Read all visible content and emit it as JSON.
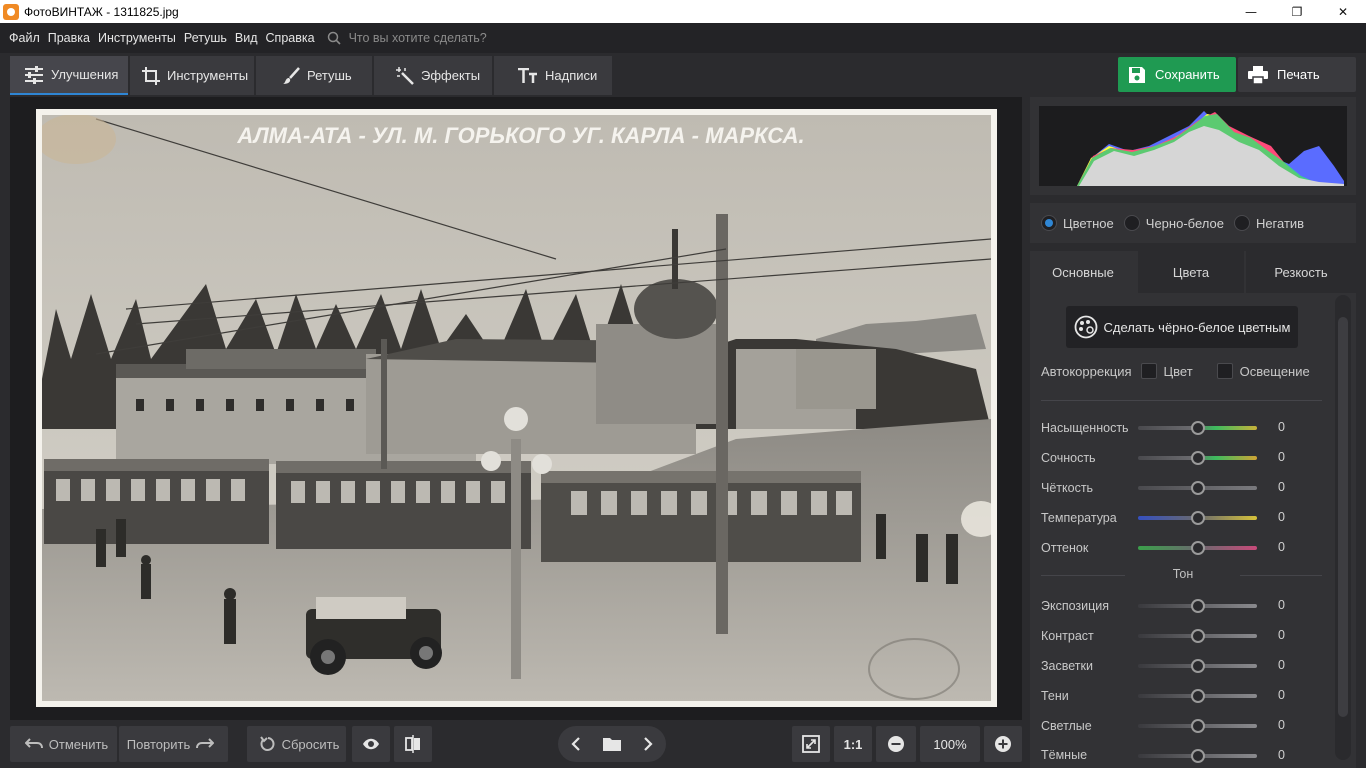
{
  "window": {
    "title": "ФотоВИНТАЖ - 1311825.jpg",
    "minimize": "—",
    "maximize": "❐",
    "close": "✕"
  },
  "menu": {
    "items": [
      "Файл",
      "Правка",
      "Инструменты",
      "Ретушь",
      "Вид",
      "Справка"
    ],
    "search_placeholder": "Что вы хотите сделать?"
  },
  "tabs": [
    {
      "label": "Улучшения",
      "icon": "sliders-icon",
      "active": true
    },
    {
      "label": "Инструменты",
      "icon": "crop-icon"
    },
    {
      "label": "Ретушь",
      "icon": "brush-icon"
    },
    {
      "label": "Эффекты",
      "icon": "magic-wand-icon"
    },
    {
      "label": "Надписи",
      "icon": "text-icon"
    }
  ],
  "actions": {
    "save": "Сохранить",
    "print": "Печать"
  },
  "photo": {
    "caption": "АЛМА-АТА - УЛ. М. ГОРЬКОГО УГ. КАРЛА - МАРКСА."
  },
  "bottom": {
    "undo": "Отменить",
    "redo": "Повторить",
    "reset": "Сбросить",
    "one_to_one": "1:1",
    "zoom": "100%"
  },
  "modes": {
    "items": [
      "Цветное",
      "Черно-белое",
      "Негатив"
    ],
    "selected": "Цветное"
  },
  "subtabs": [
    {
      "label": "Основные",
      "active": true
    },
    {
      "label": "Цвета"
    },
    {
      "label": "Резкость"
    }
  ],
  "panel": {
    "bw_to_color": "Сделать чёрно-белое цветным",
    "autocorrection": {
      "label": "Автокоррекция",
      "color": "Цвет",
      "light": "Освещение"
    },
    "sliders": [
      {
        "label": "Насыщенность",
        "value": "0"
      },
      {
        "label": "Сочность",
        "value": "0"
      },
      {
        "label": "Чёткость",
        "value": "0"
      },
      {
        "label": "Температура",
        "value": "0"
      },
      {
        "label": "Оттенок",
        "value": "0"
      }
    ],
    "tone_title": "Тон",
    "tone_sliders": [
      {
        "label": "Экспозиция",
        "value": "0"
      },
      {
        "label": "Контраст",
        "value": "0"
      },
      {
        "label": "Засветки",
        "value": "0"
      },
      {
        "label": "Тени",
        "value": "0"
      },
      {
        "label": "Светлые",
        "value": "0"
      },
      {
        "label": "Тёмные",
        "value": "0"
      }
    ]
  },
  "colors": {
    "accent": "#2f86d4",
    "save": "#1f9a52"
  }
}
